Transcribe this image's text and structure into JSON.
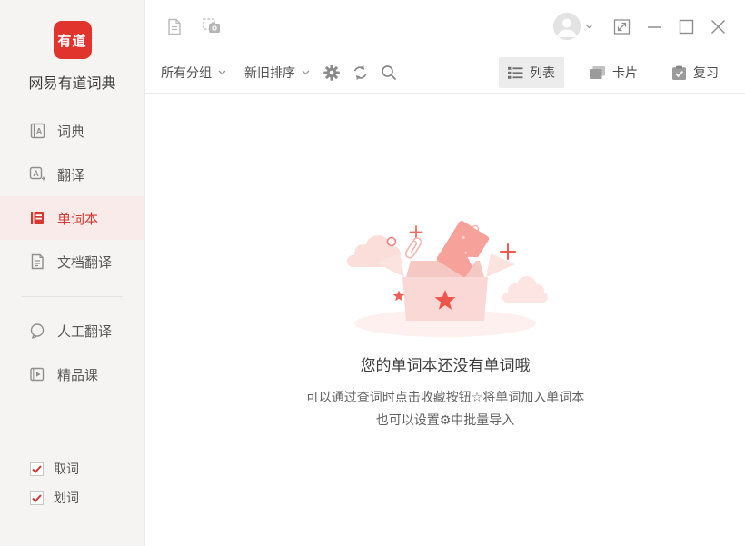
{
  "app": {
    "title": "网易有道词典",
    "logo_text": "有道"
  },
  "colors": {
    "accent_red": "#e1342c",
    "selected_text": "#d63a31",
    "sidebar_bg": "#f5f4f2",
    "selected_item_bg": "#f8ebea",
    "toolbar_selected_bg": "#ececec",
    "illustration_pink": "#fad8d5",
    "star_red": "#ee554b"
  },
  "sidebar": {
    "nav": [
      {
        "label": "词典",
        "icon": "dictionary-icon",
        "selected": false
      },
      {
        "label": "翻译",
        "icon": "translate-icon",
        "selected": false
      },
      {
        "label": "单词本",
        "icon": "wordbook-icon",
        "selected": true
      },
      {
        "label": "文档翻译",
        "icon": "document-translate-icon",
        "selected": false
      },
      {
        "label": "人工翻译",
        "icon": "human-translate-icon",
        "selected": false
      },
      {
        "label": "精品课",
        "icon": "course-icon",
        "selected": false
      }
    ],
    "toggles": [
      {
        "label": "取词",
        "checked": true
      },
      {
        "label": "划词",
        "checked": true
      }
    ]
  },
  "titlebar": {
    "left_icons": [
      "new-document-icon",
      "screenshot-capture-icon"
    ],
    "account": {
      "icon": "user-avatar-icon",
      "menu_icon": "chevron-down-icon"
    },
    "window_controls": [
      "mini-mode-icon",
      "minimize-icon",
      "maximize-icon",
      "close-icon"
    ]
  },
  "toolbar": {
    "group_filter": {
      "label": "所有分组",
      "icon": "chevron-down-icon"
    },
    "sort_order": {
      "label": "新旧排序",
      "icon": "chevron-down-icon"
    },
    "action_icons": [
      "settings-gear-icon",
      "refresh-icon",
      "search-icon"
    ],
    "views": [
      {
        "label": "列表",
        "icon": "list-view-icon",
        "selected": true
      },
      {
        "label": "卡片",
        "icon": "card-view-icon",
        "selected": false
      },
      {
        "label": "复习",
        "icon": "review-icon",
        "selected": false
      }
    ]
  },
  "empty_state": {
    "illustration": "empty-wordbook-box",
    "title": "您的单词本还没有单词哦",
    "hints": [
      "可以通过查词时点击收藏按钮☆将单词加入单词本",
      "也可以设置⚙中批量导入"
    ]
  }
}
